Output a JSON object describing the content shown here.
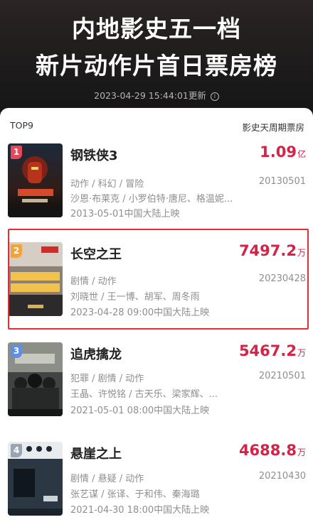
{
  "header": {
    "title_line1": "内地影史五一档",
    "title_line2": "新片动作片首日票房榜",
    "updated": "2023-04-29 15:44:01更新",
    "info_icon": "info-icon"
  },
  "list": {
    "label_left": "TOP9",
    "label_right": "影史天周期票房"
  },
  "movies": [
    {
      "rank": "1",
      "rank_color": "#e6475a",
      "title": "钢铁侠3",
      "gross_value": "1.09",
      "gross_unit": "亿",
      "genres": "动作 / 科幻 / 冒险",
      "code": "20130501",
      "cast": "沙恩·布莱克 / 小罗伯特·唐尼、格温妮...",
      "release": "2013-05-01中国大陆上映"
    },
    {
      "rank": "2",
      "rank_color": "#f0a43a",
      "title": "长空之王",
      "gross_value": "7497.2",
      "gross_unit": "万",
      "genres": "剧情 / 动作",
      "code": "20230428",
      "cast": "刘晓世 / 王一博、胡军、周冬雨",
      "release": "2023-04-28 09:00中国大陆上映"
    },
    {
      "rank": "3",
      "rank_color": "#5f8fe0",
      "title": "追虎擒龙",
      "gross_value": "5467.2",
      "gross_unit": "万",
      "genres": "犯罪 / 剧情 / 动作",
      "code": "20210501",
      "cast": "王晶、许悦铭 / 古天乐、梁家辉、...",
      "release": "2021-05-01 08:00中国大陆上映"
    },
    {
      "rank": "4",
      "rank_color": "#9aa4b2",
      "title": "悬崖之上",
      "gross_value": "4688.8",
      "gross_unit": "万",
      "genres": "剧情 / 悬疑 / 动作",
      "code": "20210430",
      "cast": "张艺谋 / 张译、于和伟、秦海璐",
      "release": "2021-04-30 18:00中国大陆上映"
    }
  ]
}
